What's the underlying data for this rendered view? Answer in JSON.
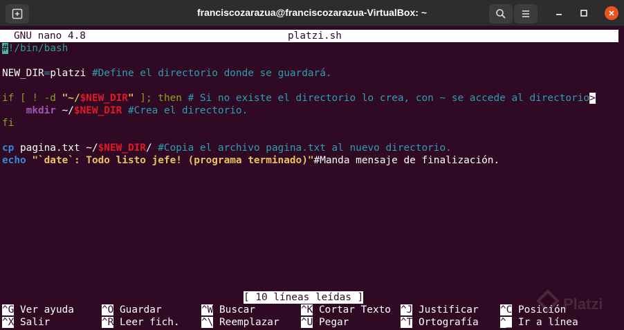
{
  "window": {
    "title": "franciscozarazua@franciscozarazua-VirtualBox: ~"
  },
  "nano": {
    "version": "GNU nano 4.8",
    "filename": "platzi.sh",
    "status": "[ 10 líneas leídas ]"
  },
  "code": {
    "l1_cursor": "#",
    "l1_rest": "!/bin/bash",
    "l3_var": "NEW_DIR",
    "l3_eq": "=",
    "l3_val": "platzi ",
    "l3_comment": "#Define el directorio donde se guardará.",
    "l5_if": "if",
    "l5_br": " [ ! -d ",
    "l5_str1": "\"~/",
    "l5_var": "$NEW_DIR",
    "l5_str2": "\"",
    "l5_br2": " ]; ",
    "l5_then": "then",
    "l5_comment": " # Si no existe el directorio lo crea, con ~ se accede al directorio",
    "l5_more": ">",
    "l6_indent": "    ",
    "l6_cmd": "mkdir",
    "l6_path": " ~/",
    "l6_var": "$NEW_DIR",
    "l6_comment": " #Crea el directorio.",
    "l7_fi": "fi",
    "l9_cmd": "cp",
    "l9_args": " pagina.txt ~/",
    "l9_var": "$NEW_DIR",
    "l9_slash": "/ ",
    "l9_comment": "#Copia el archivo pagina.txt al nuevo directorio.",
    "l10_cmd": "echo",
    "l10_str": " \"`date`: Todo listo jefe! (programa terminado)\"",
    "l10_comment": "#Manda mensaje de finalización."
  },
  "shortcuts": [
    {
      "key": "^G",
      "label": " Ver ayuda"
    },
    {
      "key": "^O",
      "label": " Guardar"
    },
    {
      "key": "^W",
      "label": " Buscar"
    },
    {
      "key": "^K",
      "label": " Cortar Texto"
    },
    {
      "key": "^J",
      "label": " Justificar"
    },
    {
      "key": "^C",
      "label": " Posición"
    },
    {
      "key": "^X",
      "label": " Salir"
    },
    {
      "key": "^R",
      "label": " Leer fich."
    },
    {
      "key": "^\\",
      "label": " Reemplazar"
    },
    {
      "key": "^U",
      "label": " Pegar"
    },
    {
      "key": "^T",
      "label": " Ortografía"
    },
    {
      "key": "^_",
      "label": " Ir a línea"
    }
  ],
  "watermark": "Platzi",
  "colors": {
    "background": "#300a24",
    "titlebar": "#2d2d2d",
    "close": "#e95420"
  }
}
